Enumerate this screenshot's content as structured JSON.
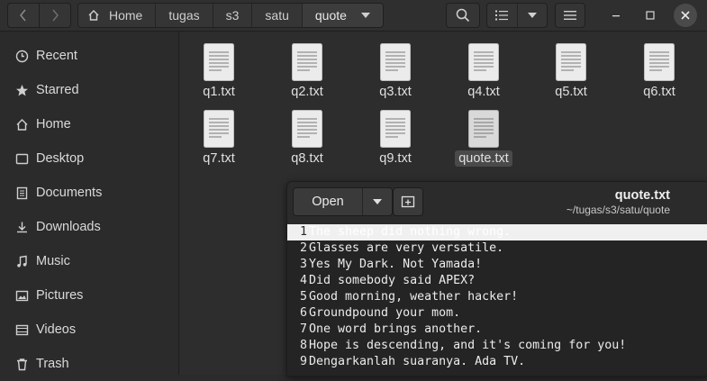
{
  "header": {
    "breadcrumbs": [
      "Home",
      "tugas",
      "s3",
      "satu",
      "quote"
    ]
  },
  "sidebar": {
    "items": [
      {
        "label": "Recent",
        "icon": "clock-icon"
      },
      {
        "label": "Starred",
        "icon": "star-icon"
      },
      {
        "label": "Home",
        "icon": "home-icon"
      },
      {
        "label": "Desktop",
        "icon": "desktop-icon"
      },
      {
        "label": "Documents",
        "icon": "documents-icon"
      },
      {
        "label": "Downloads",
        "icon": "download-icon"
      },
      {
        "label": "Music",
        "icon": "music-icon"
      },
      {
        "label": "Pictures",
        "icon": "pictures-icon"
      },
      {
        "label": "Videos",
        "icon": "videos-icon"
      },
      {
        "label": "Trash",
        "icon": "trash-icon"
      }
    ]
  },
  "files": [
    {
      "name": "q1.txt"
    },
    {
      "name": "q2.txt"
    },
    {
      "name": "q3.txt"
    },
    {
      "name": "q4.txt"
    },
    {
      "name": "q5.txt"
    },
    {
      "name": "q6.txt"
    },
    {
      "name": "q7.txt"
    },
    {
      "name": "q8.txt"
    },
    {
      "name": "q9.txt"
    },
    {
      "name": "quote.txt",
      "selected": true
    }
  ],
  "preview": {
    "open_label": "Open",
    "title": "quote.txt",
    "path": "~/tugas/s3/satu/quote",
    "lines": [
      {
        "num": "1",
        "text": "The sheep did nothing wrong."
      },
      {
        "num": "2",
        "text": "Glasses are very versatile."
      },
      {
        "num": "3",
        "text": "Yes My Dark. Not Yamada!"
      },
      {
        "num": "4",
        "text": "Did somebody said APEX?"
      },
      {
        "num": "5",
        "text": "Good morning, weather hacker!"
      },
      {
        "num": "6",
        "text": "Groundpound your mom."
      },
      {
        "num": "7",
        "text": "One word brings another."
      },
      {
        "num": "8",
        "text": "Hope is descending, and it's coming for you!"
      },
      {
        "num": "9",
        "text": "Dengarkanlah suaranya. Ada TV."
      }
    ]
  }
}
